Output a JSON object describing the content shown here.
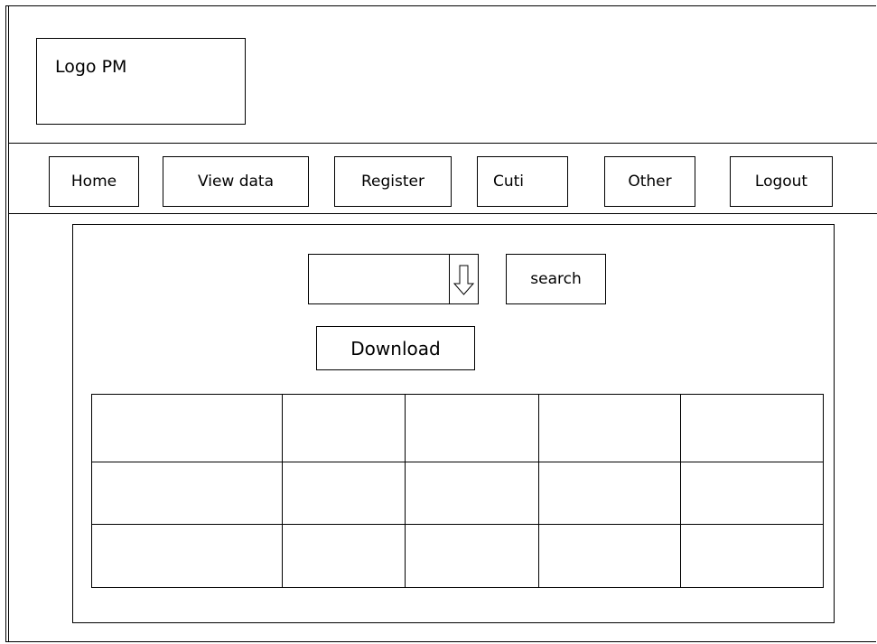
{
  "header": {
    "logo_text": "Logo PM"
  },
  "nav": {
    "items": [
      {
        "label": "Home"
      },
      {
        "label": "View data"
      },
      {
        "label": "Register"
      },
      {
        "label": "Cuti"
      },
      {
        "label": "Other"
      },
      {
        "label": "Logout"
      }
    ]
  },
  "main": {
    "dropdown": {
      "value": "",
      "icon": "down-arrow-icon"
    },
    "search_label": "search",
    "download_label": "Download",
    "table": {
      "rows": [
        [
          "",
          "",
          "",
          "",
          ""
        ],
        [
          "",
          "",
          "",
          "",
          ""
        ],
        [
          "",
          "",
          "",
          "",
          ""
        ]
      ]
    }
  }
}
